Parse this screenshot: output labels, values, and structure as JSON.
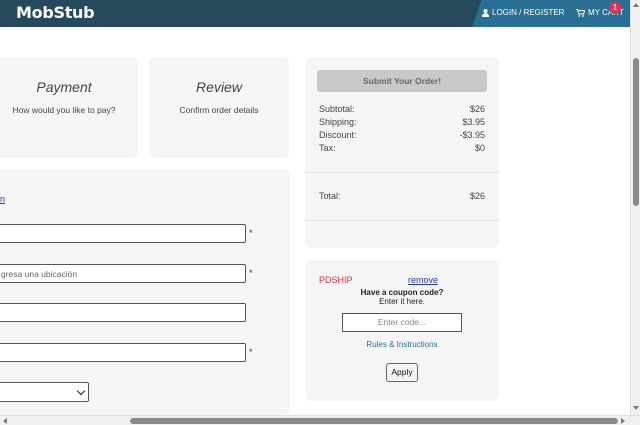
{
  "header": {
    "logo": "MobStub",
    "login_label": "LOGIN / REGISTER",
    "cart_label": "MY CART",
    "cart_count": "1",
    "user_icon": "user-icon",
    "cart_icon": "cart-icon"
  },
  "steps": [
    {
      "title": "Payment",
      "subtitle": "How would you like to pay?"
    },
    {
      "title": "Review",
      "subtitle": "Confirm order details"
    }
  ],
  "form": {
    "link_text": "n",
    "location_placeholder": "gresa una ubicación",
    "required_mark": "*"
  },
  "summary": {
    "submit_label": "Submit Your Order!",
    "subtotal_label": "Subtotal:",
    "subtotal_value": "$26",
    "shipping_label": "Shipping:",
    "shipping_value": "$3.95",
    "discount_label": "Discount:",
    "discount_value": "-$3.95",
    "tax_label": "Tax:",
    "tax_value": "$0",
    "total_label": "Total:",
    "total_value": "$26"
  },
  "coupon": {
    "applied_code": "PDSHIP",
    "remove_label": "remove",
    "question": "Have a coupon code?",
    "hint": "Enter it here.",
    "input_placeholder": "Enter code...",
    "rules_label": "Rules & Instructions",
    "apply_label": "Apply"
  },
  "colors": {
    "header_bg": "#244a5c",
    "header_accent": "#2a6f93",
    "badge": "#d8335b",
    "coupon_code": "#d0353a"
  }
}
